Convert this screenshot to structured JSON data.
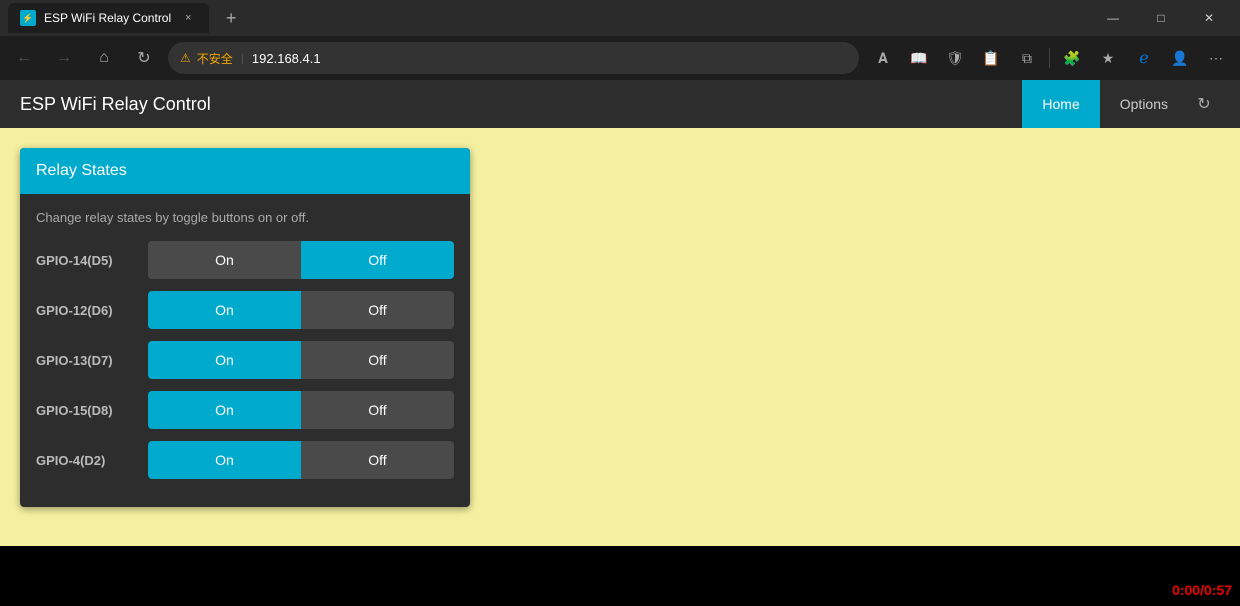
{
  "browser": {
    "tab_title": "ESP WiFi Relay Control",
    "address": "192.168.4.1",
    "security_label": "不安全",
    "new_tab_label": "+",
    "back_icon": "←",
    "forward_icon": "→",
    "home_icon": "⌂",
    "refresh_icon": "↻",
    "tab_close_icon": "×",
    "window_minimize": "—",
    "window_restore": "□",
    "window_close": "✕"
  },
  "app": {
    "title": "ESP WiFi Relay Control",
    "nav": {
      "home_label": "Home",
      "options_label": "Options",
      "refresh_icon": "↻"
    }
  },
  "relay_card": {
    "title": "Relay States",
    "instruction": "Change relay states by toggle buttons on or off.",
    "relays": [
      {
        "id": "gpio14",
        "label": "GPIO-14(D5)",
        "on_active": false,
        "off_active": true
      },
      {
        "id": "gpio12",
        "label": "GPIO-12(D6)",
        "on_active": true,
        "off_active": false
      },
      {
        "id": "gpio13",
        "label": "GPIO-13(D7)",
        "on_active": true,
        "off_active": false
      },
      {
        "id": "gpio15",
        "label": "GPIO-15(D8)",
        "on_active": true,
        "off_active": false
      },
      {
        "id": "gpio4",
        "label": "GPIO-4(D2)",
        "on_active": true,
        "off_active": false
      }
    ]
  },
  "timer": {
    "value": "0:00/0:57"
  }
}
